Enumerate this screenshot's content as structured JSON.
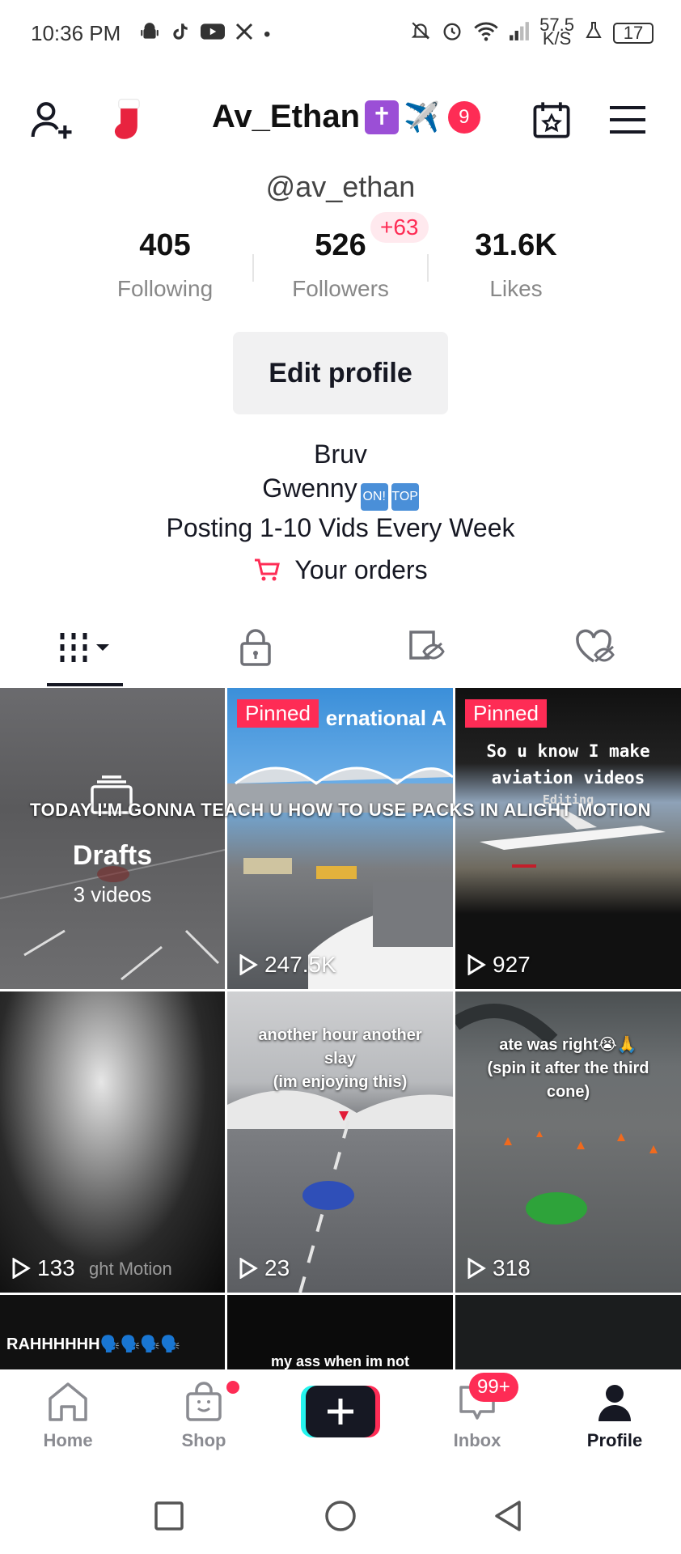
{
  "status_bar": {
    "time": "10:36 PM",
    "net_speed_value": "57.5",
    "net_speed_unit": "K/S",
    "battery": "17",
    "left_icons": [
      "android-icon",
      "tiktok-icon",
      "youtube-icon",
      "x-icon",
      "dot-icon"
    ],
    "right_icons": [
      "mute-icon",
      "alarm-icon",
      "wifi-icon",
      "signal-icon",
      "lab-icon",
      "battery-icon"
    ]
  },
  "header": {
    "title": "Av_Ethan",
    "title_emoji_cross": "✝",
    "title_emoji_plane": "✈️",
    "notification_count": "9",
    "icons": [
      "add-friend-icon",
      "stocking-icon",
      "calendar-star-icon",
      "menu-icon"
    ]
  },
  "profile": {
    "handle": "@av_ethan",
    "following_count": "405",
    "following_label": "Following",
    "followers_count": "526",
    "followers_label": "Followers",
    "followers_delta": "+63",
    "likes_count": "31.6K",
    "likes_label": "Likes",
    "edit_button": "Edit profile",
    "bio_line1": "Bruv",
    "bio_line2": "Gwenny",
    "bio_line2_emoji1": "ON!",
    "bio_line2_emoji2": "TOP",
    "bio_line3": "Posting 1-10 Vids Every Week",
    "orders_label": "Your orders"
  },
  "tabs": [
    "videos-grid-icon",
    "private-lock-icon",
    "reposts-icon",
    "liked-hidden-icon"
  ],
  "overlay_banner": "TODAY I'M GONNA TEACH U HOW TO USE PACKS IN ALIGHT MOTION",
  "grid": {
    "drafts": {
      "title": "Drafts",
      "count": "3 videos"
    },
    "pinned_label": "Pinned",
    "videos": [
      {
        "views": "247.5K",
        "caption": "ernational A"
      },
      {
        "views": "927",
        "caption_line1": "So u know I make",
        "caption_line2": "aviation videos",
        "caption_line3": "Editing"
      },
      {
        "views": "133",
        "watermark": "ght Motion"
      },
      {
        "views": "23",
        "caption_line1": "another hour another",
        "caption_line2": "slay",
        "caption_line3": "(im enjoying this)"
      },
      {
        "views": "318",
        "caption_line1": "ate was right😭🙏",
        "caption_line2": "(spin it after the third",
        "caption_line3": "cone)"
      },
      {
        "caption": "RAHHHHHH🗣️🗣️🗣️🗣️"
      },
      {
        "caption": "my ass when im not"
      },
      {
        "caption": ""
      }
    ]
  },
  "bottom_nav": {
    "home": "Home",
    "shop": "Shop",
    "inbox": "Inbox",
    "inbox_badge": "99+",
    "profile": "Profile"
  },
  "colors": {
    "accent": "#fe2c55",
    "text": "#161823",
    "muted": "#888888",
    "cyan": "#25f4ee"
  }
}
